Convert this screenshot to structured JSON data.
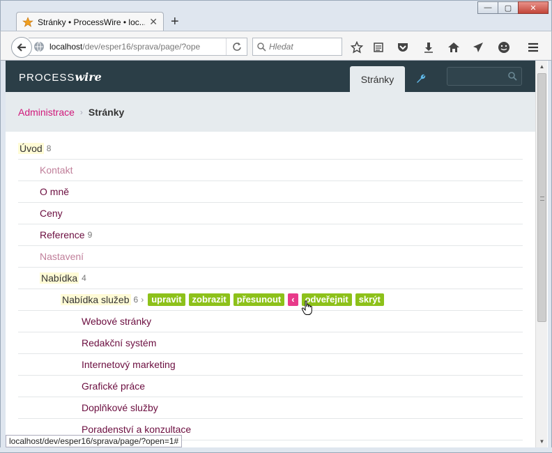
{
  "browser": {
    "tab_title": "Stránky • ProcessWire • loc...",
    "tab_close": "✕",
    "new_tab": "+",
    "url_host": "localhost",
    "url_path": "/dev/esper16/sprava/page/?ope",
    "search_placeholder": "Hledat",
    "window_minimize": "—",
    "window_maximize": "▢",
    "window_close": "✕",
    "status_url": "localhost/dev/esper16/sprava/page/?open=1#"
  },
  "header": {
    "logo_text": "PROCESS",
    "logo_wire": "wire",
    "nav_tab": "Stránky"
  },
  "breadcrumb": {
    "root": "Administrace",
    "separator": "›",
    "current": "Stránky"
  },
  "tree": {
    "rows": [
      {
        "label": "Úvod",
        "count": "8"
      },
      {
        "label": "Kontakt"
      },
      {
        "label": "O mně"
      },
      {
        "label": "Ceny"
      },
      {
        "label": "Reference",
        "count": "9"
      },
      {
        "label": "Nastavení"
      },
      {
        "label": "Nabídka",
        "count": "4"
      },
      {
        "label": "Nabídka služeb",
        "count": "6",
        "arrow": "›"
      },
      {
        "label": "Webové stránky"
      },
      {
        "label": "Redakční systém"
      },
      {
        "label": "Internetový marketing"
      },
      {
        "label": "Grafické práce"
      },
      {
        "label": "Doplňkové služby"
      },
      {
        "label": "Poradenství a konzultace"
      }
    ],
    "actions": {
      "edit": "upravit",
      "view": "zobrazit",
      "move": "přesunout",
      "more": "‹",
      "unpublish": "odveřejnit",
      "hide": "skrýt"
    }
  },
  "colors": {
    "header_bg": "#2b3e47",
    "accent_pink": "#d0187a",
    "action_green": "#8dc11a",
    "page_link": "#6b0d3f"
  }
}
